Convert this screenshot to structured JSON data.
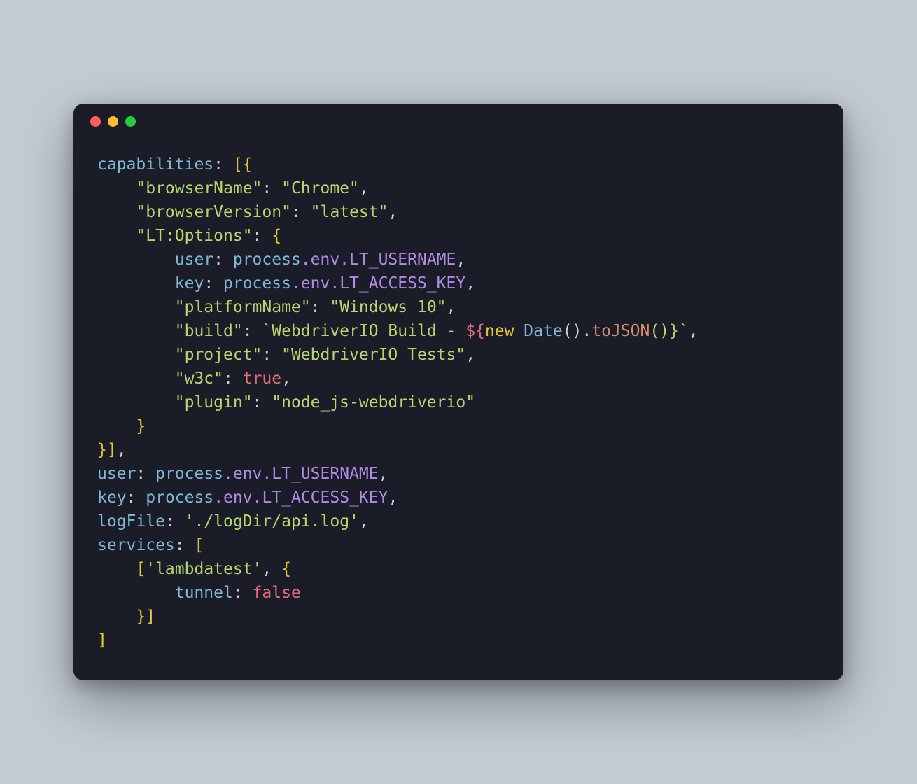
{
  "window": {
    "traffic": [
      "close",
      "minimize",
      "zoom"
    ]
  },
  "code": {
    "capabilities_label": "capabilities",
    "browserName_key": "\"browserName\"",
    "browserName_val": "\"Chrome\"",
    "browserVersion_key": "\"browserVersion\"",
    "browserVersion_val": "\"latest\"",
    "ltOptions_key": "\"LT:Options\"",
    "user_label": "user",
    "key_label": "key",
    "process": "process",
    "env": ".env.",
    "lt_username": "LT_USERNAME",
    "lt_access_key": "LT_ACCESS_KEY",
    "platformName_key": "\"platformName\"",
    "platformName_val": "\"Windows 10\"",
    "build_key": "\"build\"",
    "build_prefix": "`WebdriverIO Build - ",
    "build_new": "new",
    "build_date": " Date",
    "build_parens": "().",
    "build_tojson": "toJSON",
    "build_suffix": "()}`",
    "project_key": "\"project\"",
    "project_val": "\"WebdriverIO Tests\"",
    "w3c_key": "\"w3c\"",
    "w3c_val": "true",
    "plugin_key": "\"plugin\"",
    "plugin_val": "\"node_js-webdriverio\"",
    "logFile_label": "logFile",
    "logFile_val": "'./logDir/api.log'",
    "services_label": "services",
    "lambdatest_val": "'lambdatest'",
    "tunnel_label": "tunnel",
    "tunnel_val": "false",
    "open_sq": "[",
    "close_sq": "]",
    "open_br": "{",
    "close_br": "}",
    "colon": ": ",
    "comma": ",",
    "dollar_open": "${",
    "close_interp": "}"
  }
}
